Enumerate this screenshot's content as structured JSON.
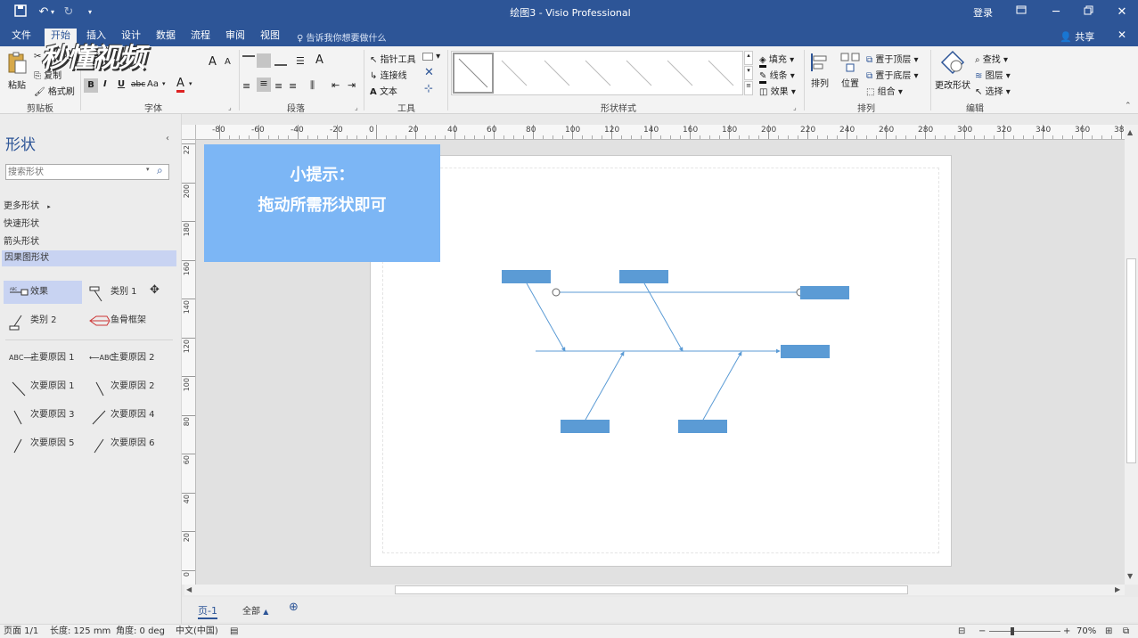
{
  "window": {
    "title": "绘图3  -  Visio Professional",
    "login": "登录"
  },
  "menu": {
    "tabs": [
      "文件",
      "开始",
      "插入",
      "设计",
      "数据",
      "流程",
      "审阅",
      "视图"
    ],
    "active_index": 1,
    "tell_me": "告诉我你想要做什么",
    "share": "共享"
  },
  "ribbon": {
    "clipboard": {
      "paste": "粘贴",
      "copy": "复制",
      "format_painter": "格式刷",
      "label": "剪贴板"
    },
    "font": {
      "bold": "B",
      "italic": "I",
      "underline": "U",
      "strike": "abc",
      "case": "Aa",
      "color_a": "A",
      "grow": "A",
      "shrink": "A",
      "label": "字体"
    },
    "paragraph": {
      "label": "段落"
    },
    "tools": {
      "pointer": "指针工具",
      "connector": "连接线",
      "text": "文本",
      "label": "工具"
    },
    "shape_styles": {
      "label": "形状样式",
      "fill": "填充",
      "line": "线条",
      "effects": "效果"
    },
    "arrange": {
      "align": "排列",
      "position": "位置",
      "bring_front": "置于顶层",
      "send_back": "置于底层",
      "group": "组合",
      "label": "排列"
    },
    "editing": {
      "change_shape": "更改形状",
      "find": "查找",
      "layers": "图层",
      "select": "选择",
      "label": "编辑"
    }
  },
  "watermark": "秒懂视频",
  "shapes_panel": {
    "title": "形状",
    "search_placeholder": "搜索形状",
    "stencils": [
      "更多形状",
      "快速形状",
      "箭头形状",
      "因果图形状"
    ],
    "selected_stencil_index": 3,
    "items": [
      {
        "label": "效果",
        "icon": "effect-icon"
      },
      {
        "label": "类别 1",
        "icon": "category1-icon"
      },
      {
        "label": "类别 2",
        "icon": "category2-icon"
      },
      {
        "label": "鱼骨框架",
        "icon": "fishbone-frame-icon"
      },
      {
        "label": "主要原因 1",
        "icon": "primary-cause1-icon"
      },
      {
        "label": "主要原因 2",
        "icon": "primary-cause2-icon"
      },
      {
        "label": "次要原因 1",
        "icon": "secondary-cause1-icon"
      },
      {
        "label": "次要原因 2",
        "icon": "secondary-cause2-icon"
      },
      {
        "label": "次要原因 3",
        "icon": "secondary-cause3-icon"
      },
      {
        "label": "次要原因 4",
        "icon": "secondary-cause4-icon"
      },
      {
        "label": "次要原因 5",
        "icon": "secondary-cause5-icon"
      },
      {
        "label": "次要原因 6",
        "icon": "secondary-cause6-icon"
      }
    ]
  },
  "ruler": {
    "top_ticks": [
      "-80",
      "-60",
      "-40",
      "-20",
      "0",
      "20",
      "40",
      "60",
      "80",
      "100",
      "120",
      "140",
      "160",
      "180",
      "200",
      "220",
      "240",
      "260",
      "280",
      "300",
      "320",
      "340",
      "360",
      "38"
    ],
    "left_ticks": [
      "22",
      "200",
      "180",
      "160",
      "140",
      "120",
      "100",
      "80",
      "60",
      "40",
      "20",
      "0"
    ]
  },
  "hint": {
    "line1": "小提示：",
    "line2": "拖动所需形状即可"
  },
  "page_tabs": {
    "page": "页-1",
    "all": "全部"
  },
  "status": {
    "page": "页面 1/1",
    "length": "长度: 125 mm",
    "angle": "角度: 0 deg",
    "language": "中文(中国)",
    "zoom": "70%"
  },
  "colors": {
    "titlebar": "#2d5597",
    "hint_bg": "#7cb6f5",
    "shape_fill": "#5b9bd5",
    "selected_stencil": "#c8d3f2"
  }
}
